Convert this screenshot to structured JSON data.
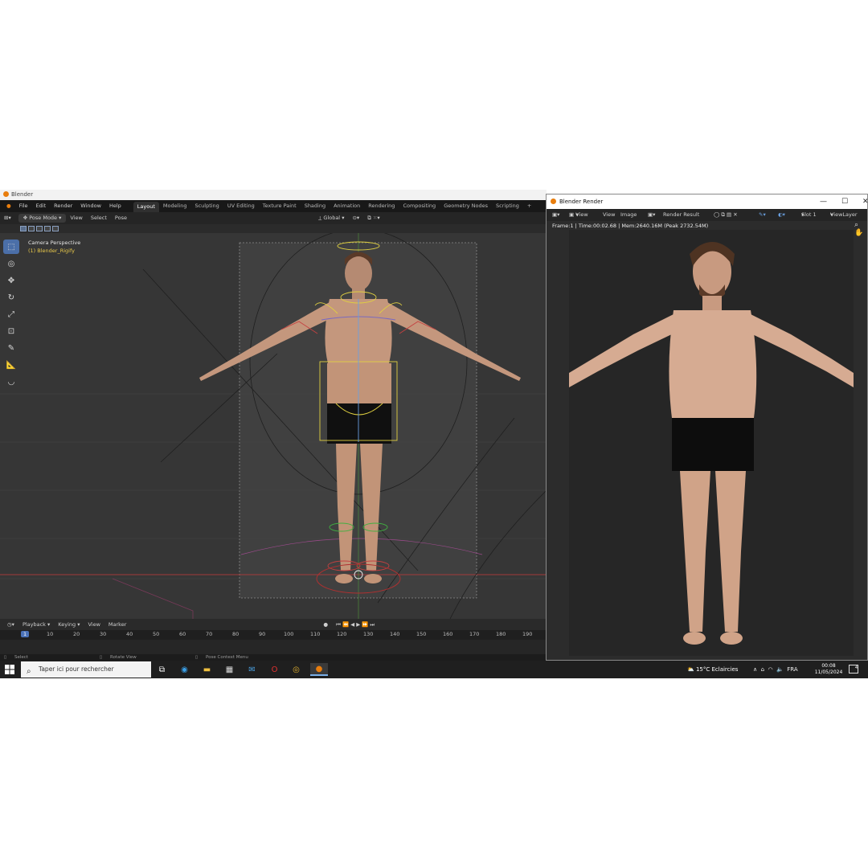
{
  "blender_window": {
    "title": "Blender",
    "menu": [
      "File",
      "Edit",
      "Render",
      "Window",
      "Help"
    ],
    "workspaces": [
      "Layout",
      "Modeling",
      "Sculpting",
      "UV Editing",
      "Texture Paint",
      "Shading",
      "Animation",
      "Rendering",
      "Compositing",
      "Geometry Nodes",
      "Scripting",
      "+"
    ],
    "active_workspace": "Layout",
    "header": {
      "mode": "Pose Mode",
      "items": [
        "View",
        "Select",
        "Pose"
      ],
      "transform_orientation": "Global"
    },
    "viewport": {
      "view_name": "Camera Perspective",
      "object_name": "(1) Blender_Rigify"
    },
    "tools": [
      "select-box",
      "cursor",
      "move",
      "rotate",
      "scale",
      "transform",
      "annotate",
      "measure",
      "bone-roll"
    ],
    "timeline": {
      "menu": [
        "Playback",
        "Keying",
        "View",
        "Marker"
      ],
      "current_frame": "1",
      "frame_labels": [
        "10",
        "20",
        "30",
        "40",
        "50",
        "60",
        "70",
        "80",
        "90",
        "100",
        "110",
        "120",
        "130",
        "140",
        "150",
        "160",
        "170",
        "180",
        "190"
      ]
    },
    "status_bar": {
      "left": "Select",
      "middle": "Rotate View",
      "right": "Pose Context Menu"
    }
  },
  "render_window": {
    "title": "Blender Render",
    "menu": [
      "View",
      "View",
      "Image"
    ],
    "image_name": "Render Result",
    "slot": "Slot 1",
    "view_layer": "ViewLayer",
    "info": "Frame:1 | Time:00:02.68 | Mem:2640.16M (Peak 2732.54M)"
  },
  "taskbar": {
    "search_placeholder": "Taper ici pour rechercher",
    "weather": "15°C  Eclaircies",
    "language": "FRA",
    "time": "00:08",
    "date": "11/05/2024",
    "notification_count": "4"
  },
  "colors": {
    "blender_accent": "#e87d0d",
    "active_tool": "#4b6fa8",
    "object_name": "#e8c84a"
  }
}
